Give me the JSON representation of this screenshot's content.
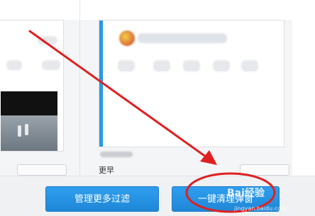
{
  "colors": {
    "accent": "#2a97e6",
    "annotation": "#e02020"
  },
  "left_card": {
    "thumbnail": "video-thumbnail"
  },
  "right_card": {
    "caption": "更早"
  },
  "buttons": {
    "manage_label": "管理更多过滤",
    "clean_label": "一键清理弹窗"
  },
  "watermark": {
    "brand": "Bai经验",
    "site": "jingyan.baidu.com"
  }
}
